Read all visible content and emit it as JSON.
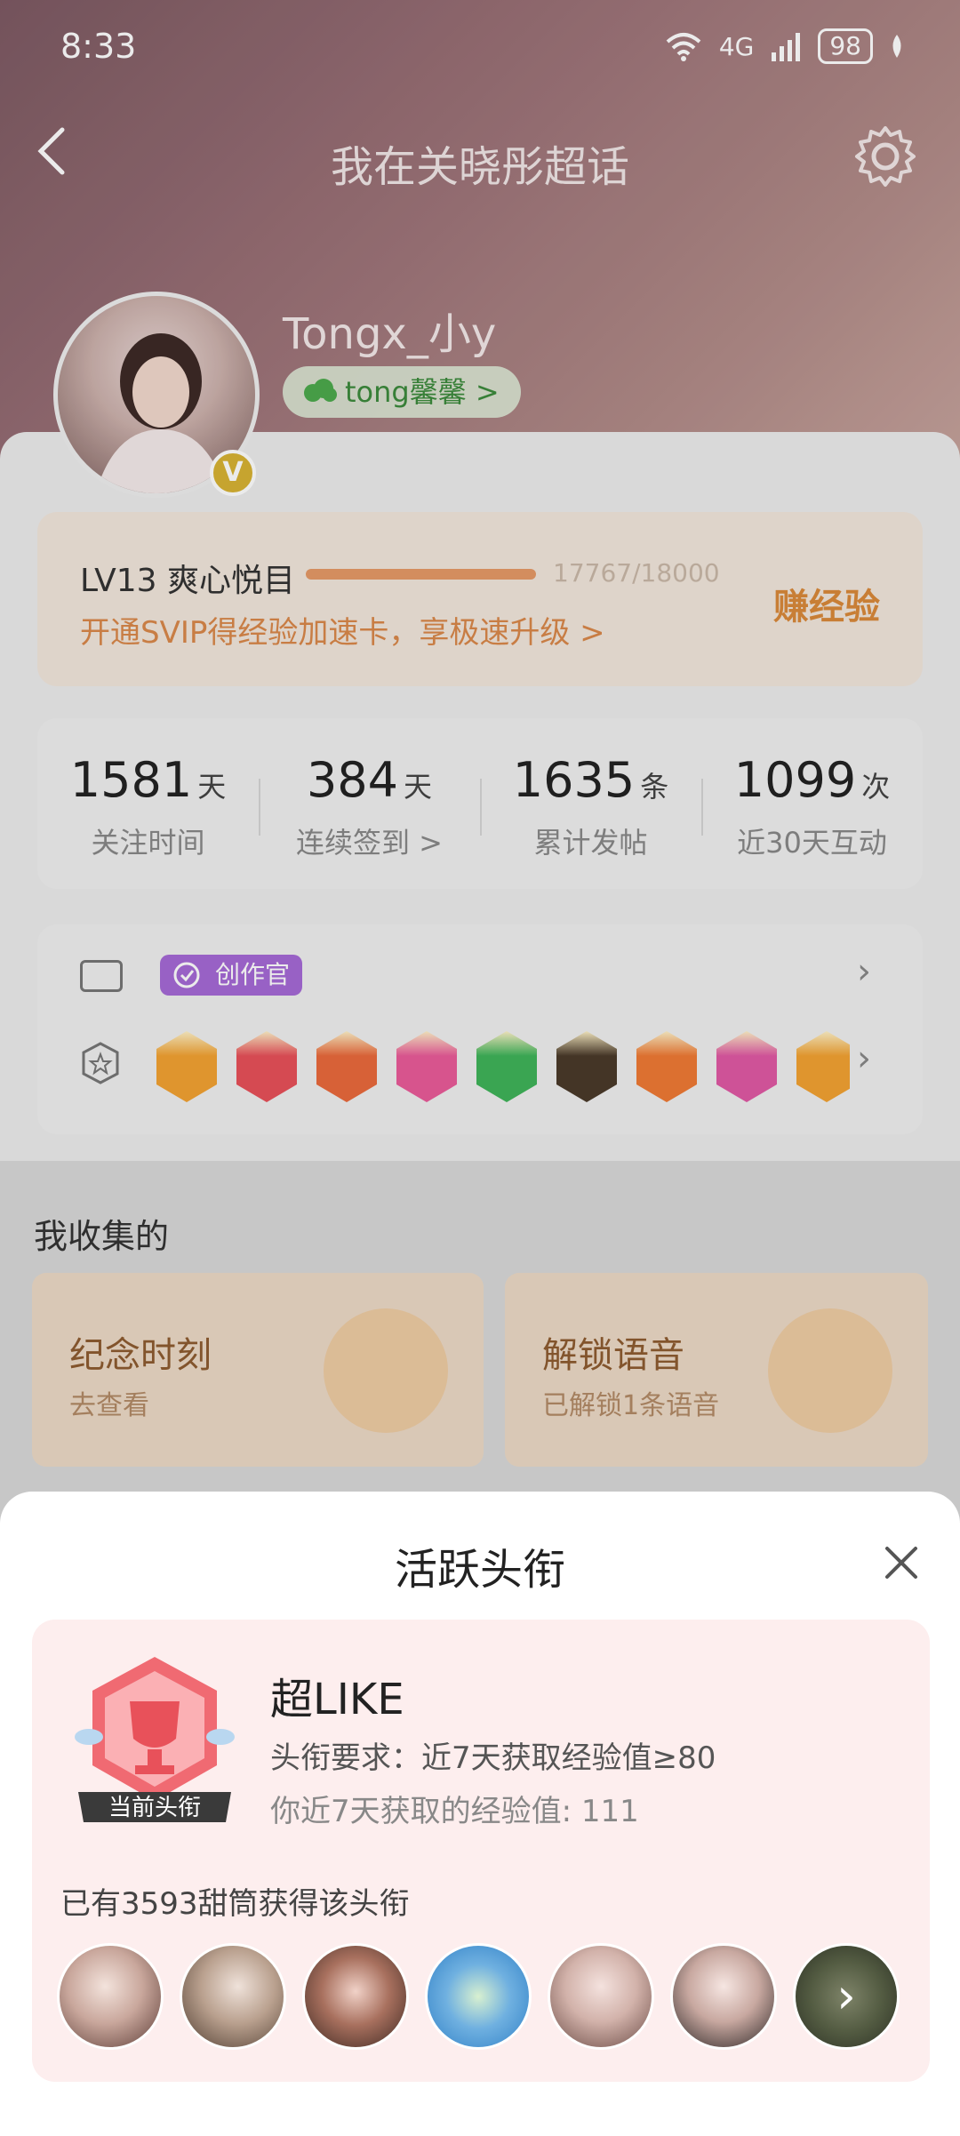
{
  "status": {
    "time": "8:33",
    "network": "4G",
    "battery": "98"
  },
  "nav": {
    "title": "我在关晓彤超话"
  },
  "profile": {
    "username": "Tongx_小y",
    "nickname": "tong馨馨 >"
  },
  "level": {
    "title": "LV13 爽心悦目",
    "progress": "17767/18000",
    "progress_fraction": 0.987,
    "upgrade": "开通SVIP得经验加速卡，享极速升级 >",
    "earn": "赚经验"
  },
  "stats": [
    {
      "value": "1581",
      "unit": "天",
      "label": "关注时间"
    },
    {
      "value": "384",
      "unit": "天",
      "label": "连续签到 >"
    },
    {
      "value": "1635",
      "unit": "条",
      "label": "累计发帖"
    },
    {
      "value": "1099",
      "unit": "次",
      "label": "近30天互动"
    }
  ],
  "badges": {
    "creator_tag": "创作官",
    "medals": [
      {
        "color": "#f2a232"
      },
      {
        "color": "#e8515a"
      },
      {
        "color": "#ea6a3c"
      },
      {
        "color": "#ea5c9a"
      },
      {
        "color": "#3fb45a"
      },
      {
        "color": "#4a3a2a"
      },
      {
        "color": "#ef7a35"
      },
      {
        "color": "#e05aa4"
      },
      {
        "color": "#f2a232"
      }
    ]
  },
  "collection": {
    "title": "我收集的",
    "cards": [
      {
        "title": "纪念时刻",
        "sub": "去查看"
      },
      {
        "title": "解锁语音",
        "sub": "已解锁1条语音"
      }
    ]
  },
  "sheet": {
    "title": "活跃头衔",
    "badge_label": "当前头衔",
    "badge_name": "超LIKE",
    "requirement": "头衔要求：近7天获取经验值≥80",
    "mine": "你近7天获取的经验值: 111",
    "owners": "已有3593甜筒获得该头衔",
    "more_glyph": "›"
  },
  "colors": {
    "accent": "#e8515a",
    "orange": "#e59a66"
  }
}
